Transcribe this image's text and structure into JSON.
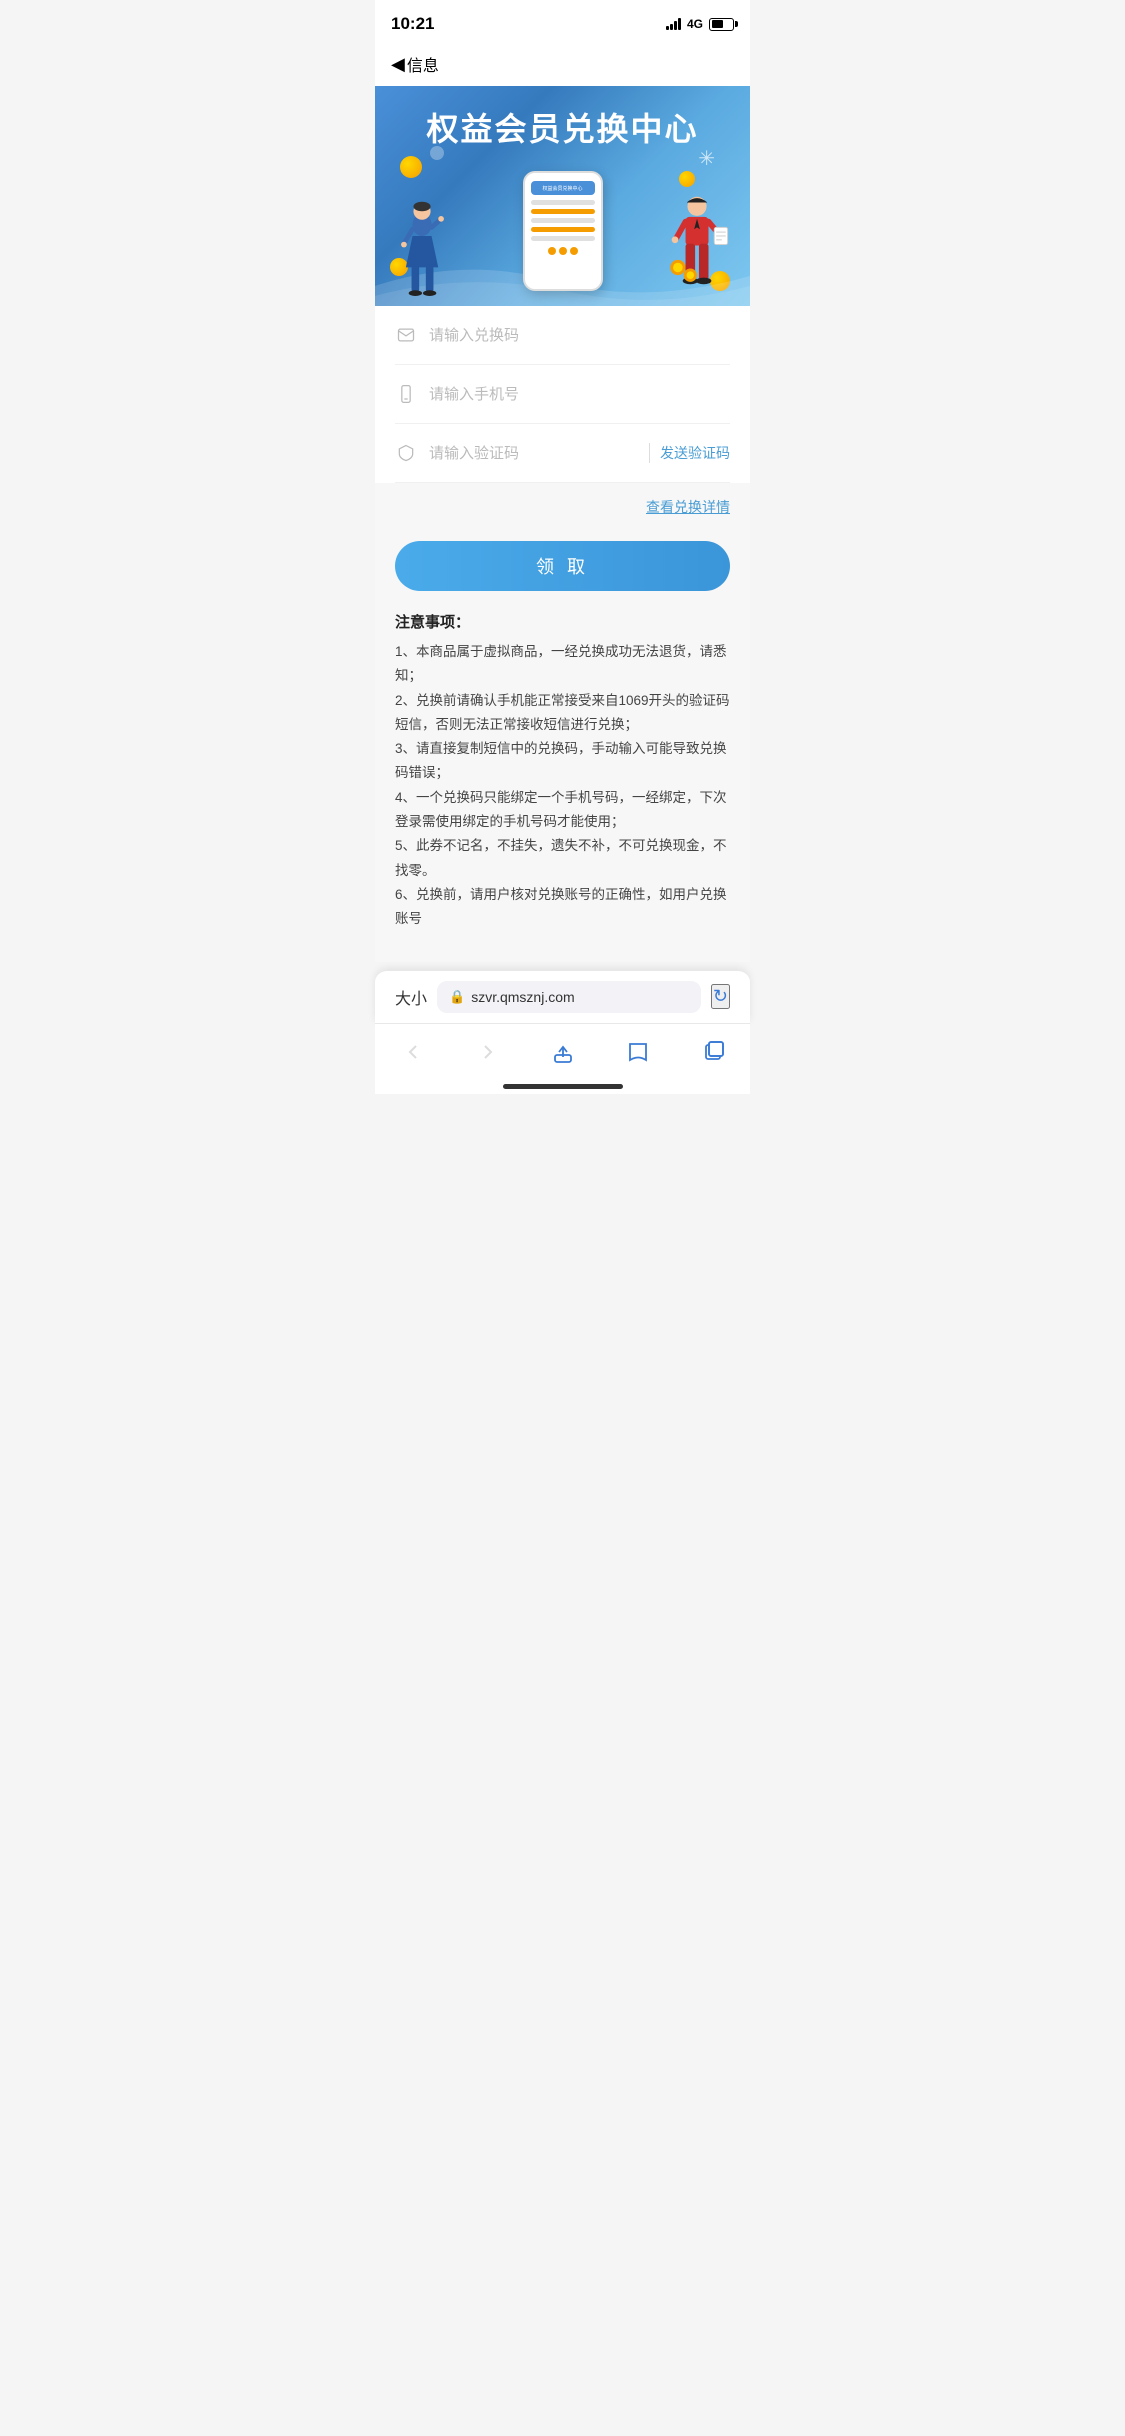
{
  "statusBar": {
    "time": "10:21",
    "network": "4G"
  },
  "navBar": {
    "backArrow": "◀",
    "backLabel": "信息"
  },
  "banner": {
    "title": "权益会员兑换中心"
  },
  "form": {
    "exchangeCodePlaceholder": "请输入兑换码",
    "phonePlaceholder": "请输入手机号",
    "verificationCodePlaceholder": "请输入验证码",
    "sendCodeLabel": "发送验证码"
  },
  "detailLink": "查看兑换详情",
  "submitButton": "领 取",
  "notes": {
    "title": "注意事项：",
    "items": [
      "1、本商品属于虚拟商品，一经兑换成功无法退货，请悉知；",
      "2、兑换前请确认手机能正常接受来自1069开头的验证码短信，否则无法正常接收短信进行兑换；",
      "3、请直接复制短信中的兑换码，手动输入可能导致兑换码错误；",
      "4、一个兑换码只能绑定一个手机号码，一经绑定，下次登录需使用绑定的手机号码才能使用；",
      "5、此券不记名，不挂失，遗失不补，不可兑换现金，不找零。",
      "6、兑换前，请用户核对兑换账号的正确性，如用户兑换账号"
    ]
  },
  "browserBar": {
    "sizeLabel": "大小",
    "url": "szvr.qmsznj.com"
  }
}
